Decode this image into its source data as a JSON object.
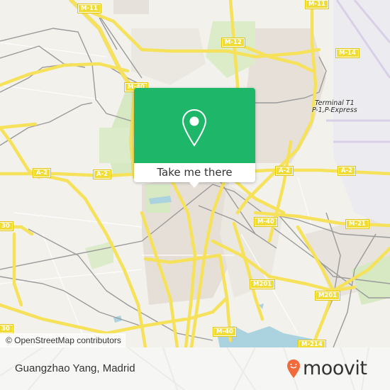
{
  "map": {
    "road_shields": [
      "M-11",
      "M-11",
      "M-12",
      "M-14",
      "M-40",
      "A-2",
      "A-2",
      "A-2",
      "A-2",
      "M-40",
      "M-21",
      "M201",
      "M201",
      "M-40",
      "M-214",
      "30",
      "30"
    ],
    "poi_labels": [
      {
        "line1": "Terminal T1",
        "line2": "P-1,P-Express"
      }
    ],
    "attribution": "© OpenStreetMap contributors",
    "colors": {
      "background": "#f2f1ec",
      "major_road": "#f6e25a",
      "rail": "#999999",
      "water": "#aad3df",
      "park": "#d4ebbf",
      "urban": "#e2dcd6"
    }
  },
  "popup": {
    "icon": "map-pin-icon",
    "button_label": "Take me there",
    "accent_color": "#1eb76a"
  },
  "footer": {
    "place_name": "Guangzhao Yang, Madrid",
    "brand": "moovit",
    "brand_color": "#f26a3c"
  }
}
